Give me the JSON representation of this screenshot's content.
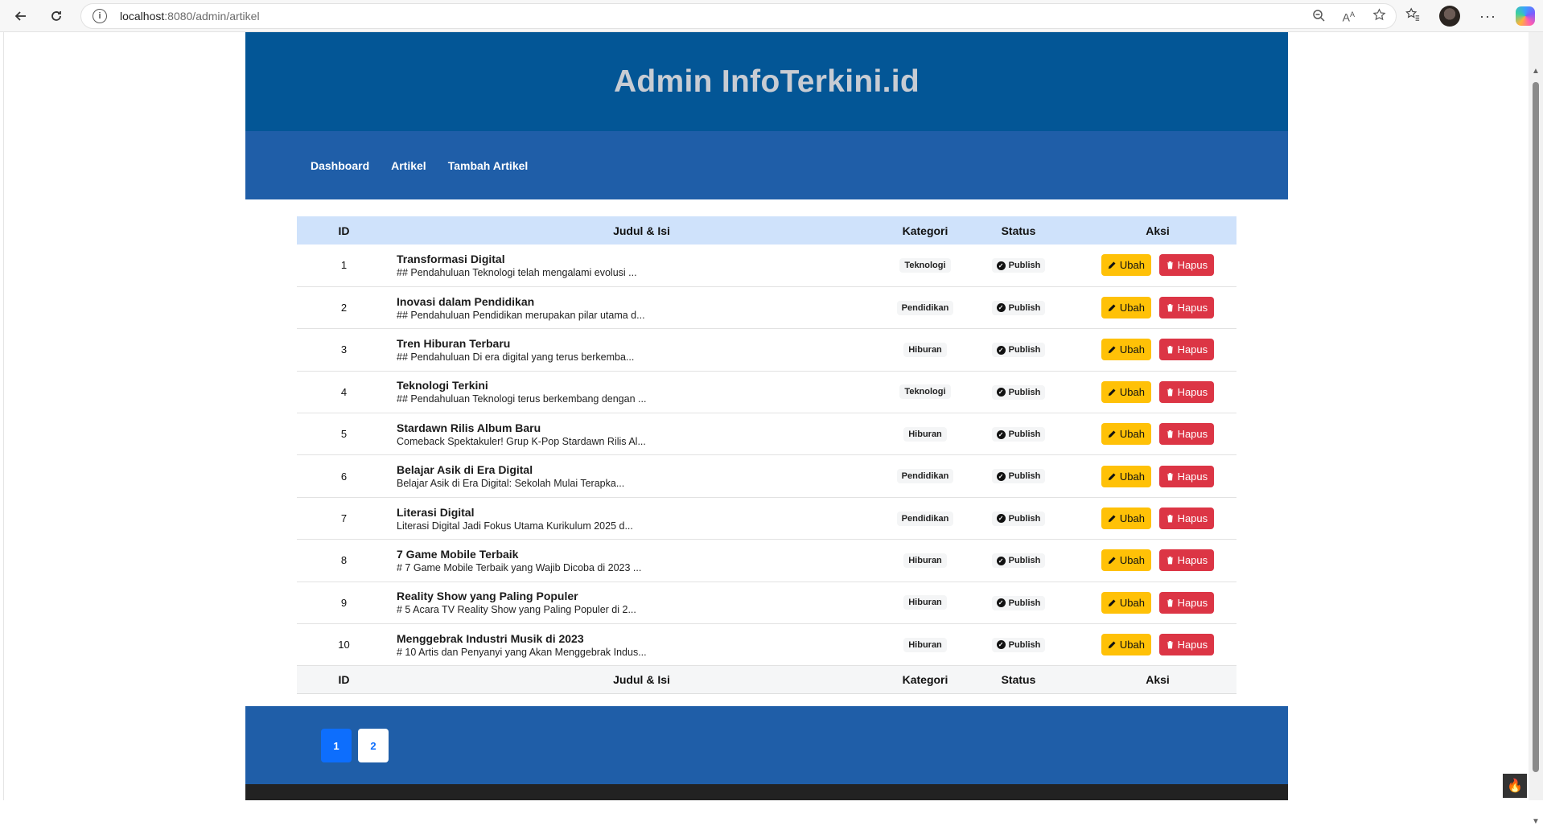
{
  "browser": {
    "url_host": "localhost",
    "url_rest": ":8080/admin/artikel"
  },
  "page": {
    "title": "Admin InfoTerkini.id",
    "nav": [
      "Dashboard",
      "Artikel",
      "Tambah Artikel"
    ]
  },
  "table": {
    "headers": {
      "id": "ID",
      "title": "Judul & Isi",
      "kategori": "Kategori",
      "status": "Status",
      "aksi": "Aksi"
    },
    "edit_label": "Ubah",
    "delete_label": "Hapus",
    "rows": [
      {
        "id": "1",
        "title": "Transformasi Digital",
        "snippet": "## Pendahuluan Teknologi telah mengalami evolusi ...",
        "kategori": "Teknologi",
        "status": "Publish"
      },
      {
        "id": "2",
        "title": "Inovasi dalam Pendidikan",
        "snippet": "## Pendahuluan Pendidikan merupakan pilar utama d...",
        "kategori": "Pendidikan",
        "status": "Publish"
      },
      {
        "id": "3",
        "title": "Tren Hiburan Terbaru",
        "snippet": "## Pendahuluan Di era digital yang terus berkemba...",
        "kategori": "Hiburan",
        "status": "Publish"
      },
      {
        "id": "4",
        "title": "Teknologi Terkini",
        "snippet": "## Pendahuluan Teknologi terus berkembang dengan ...",
        "kategori": "Teknologi",
        "status": "Publish"
      },
      {
        "id": "5",
        "title": "Stardawn Rilis Album Baru",
        "snippet": "Comeback Spektakuler! Grup K-Pop Stardawn Rilis Al...",
        "kategori": "Hiburan",
        "status": "Publish"
      },
      {
        "id": "6",
        "title": "Belajar Asik di Era Digital",
        "snippet": "Belajar Asik di Era Digital: Sekolah Mulai Terapka...",
        "kategori": "Pendidikan",
        "status": "Publish"
      },
      {
        "id": "7",
        "title": "Literasi Digital",
        "snippet": "Literasi Digital Jadi Fokus Utama Kurikulum 2025 d...",
        "kategori": "Pendidikan",
        "status": "Publish"
      },
      {
        "id": "8",
        "title": "7 Game Mobile Terbaik",
        "snippet": "# 7 Game Mobile Terbaik yang Wajib Dicoba di 2023 ...",
        "kategori": "Hiburan",
        "status": "Publish"
      },
      {
        "id": "9",
        "title": "Reality Show yang Paling Populer",
        "snippet": "# 5 Acara TV Reality Show yang Paling Populer di 2...",
        "kategori": "Hiburan",
        "status": "Publish"
      },
      {
        "id": "10",
        "title": "Menggebrak Industri Musik di 2023",
        "snippet": "# 10 Artis dan Penyanyi yang Akan Menggebrak Indus...",
        "kategori": "Hiburan",
        "status": "Publish"
      }
    ]
  },
  "pagination": {
    "pages": [
      "1",
      "2"
    ],
    "current": "1"
  },
  "colors": {
    "header_bg": "#035696",
    "nav_bg": "#1f5ea8",
    "thead_bg": "#cfe2fb",
    "edit_btn": "#ffc107",
    "delete_btn": "#dc3545",
    "active_page": "#0d6efd"
  }
}
